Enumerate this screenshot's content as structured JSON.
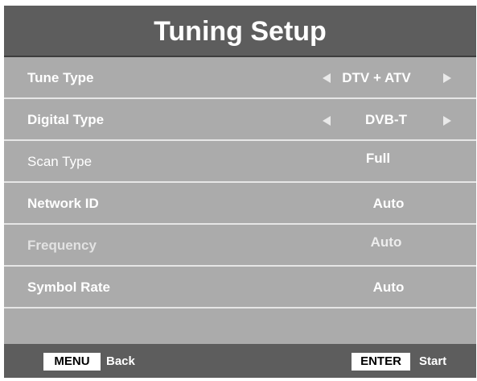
{
  "title": "Tuning Setup",
  "rows": [
    {
      "label": "Tune Type",
      "value": "DTV + ATV"
    },
    {
      "label": "Digital Type",
      "value": "DVB-T"
    },
    {
      "label": "Scan Type",
      "value": "Full"
    },
    {
      "label": "Network ID",
      "value": "Auto"
    },
    {
      "label": "Frequency",
      "value": "Auto"
    },
    {
      "label": "Symbol Rate",
      "value": "Auto"
    }
  ],
  "footer": {
    "menu_key": "MENU",
    "menu_action": "Back",
    "enter_key": "ENTER",
    "enter_action": "Start"
  },
  "colors": {
    "header_bg": "#5d5d5d",
    "body_bg": "#ababab",
    "text": "#ffffff",
    "arrow": "#e9e9e9"
  },
  "icons": [
    "arrow-left-icon",
    "arrow-right-icon"
  ]
}
